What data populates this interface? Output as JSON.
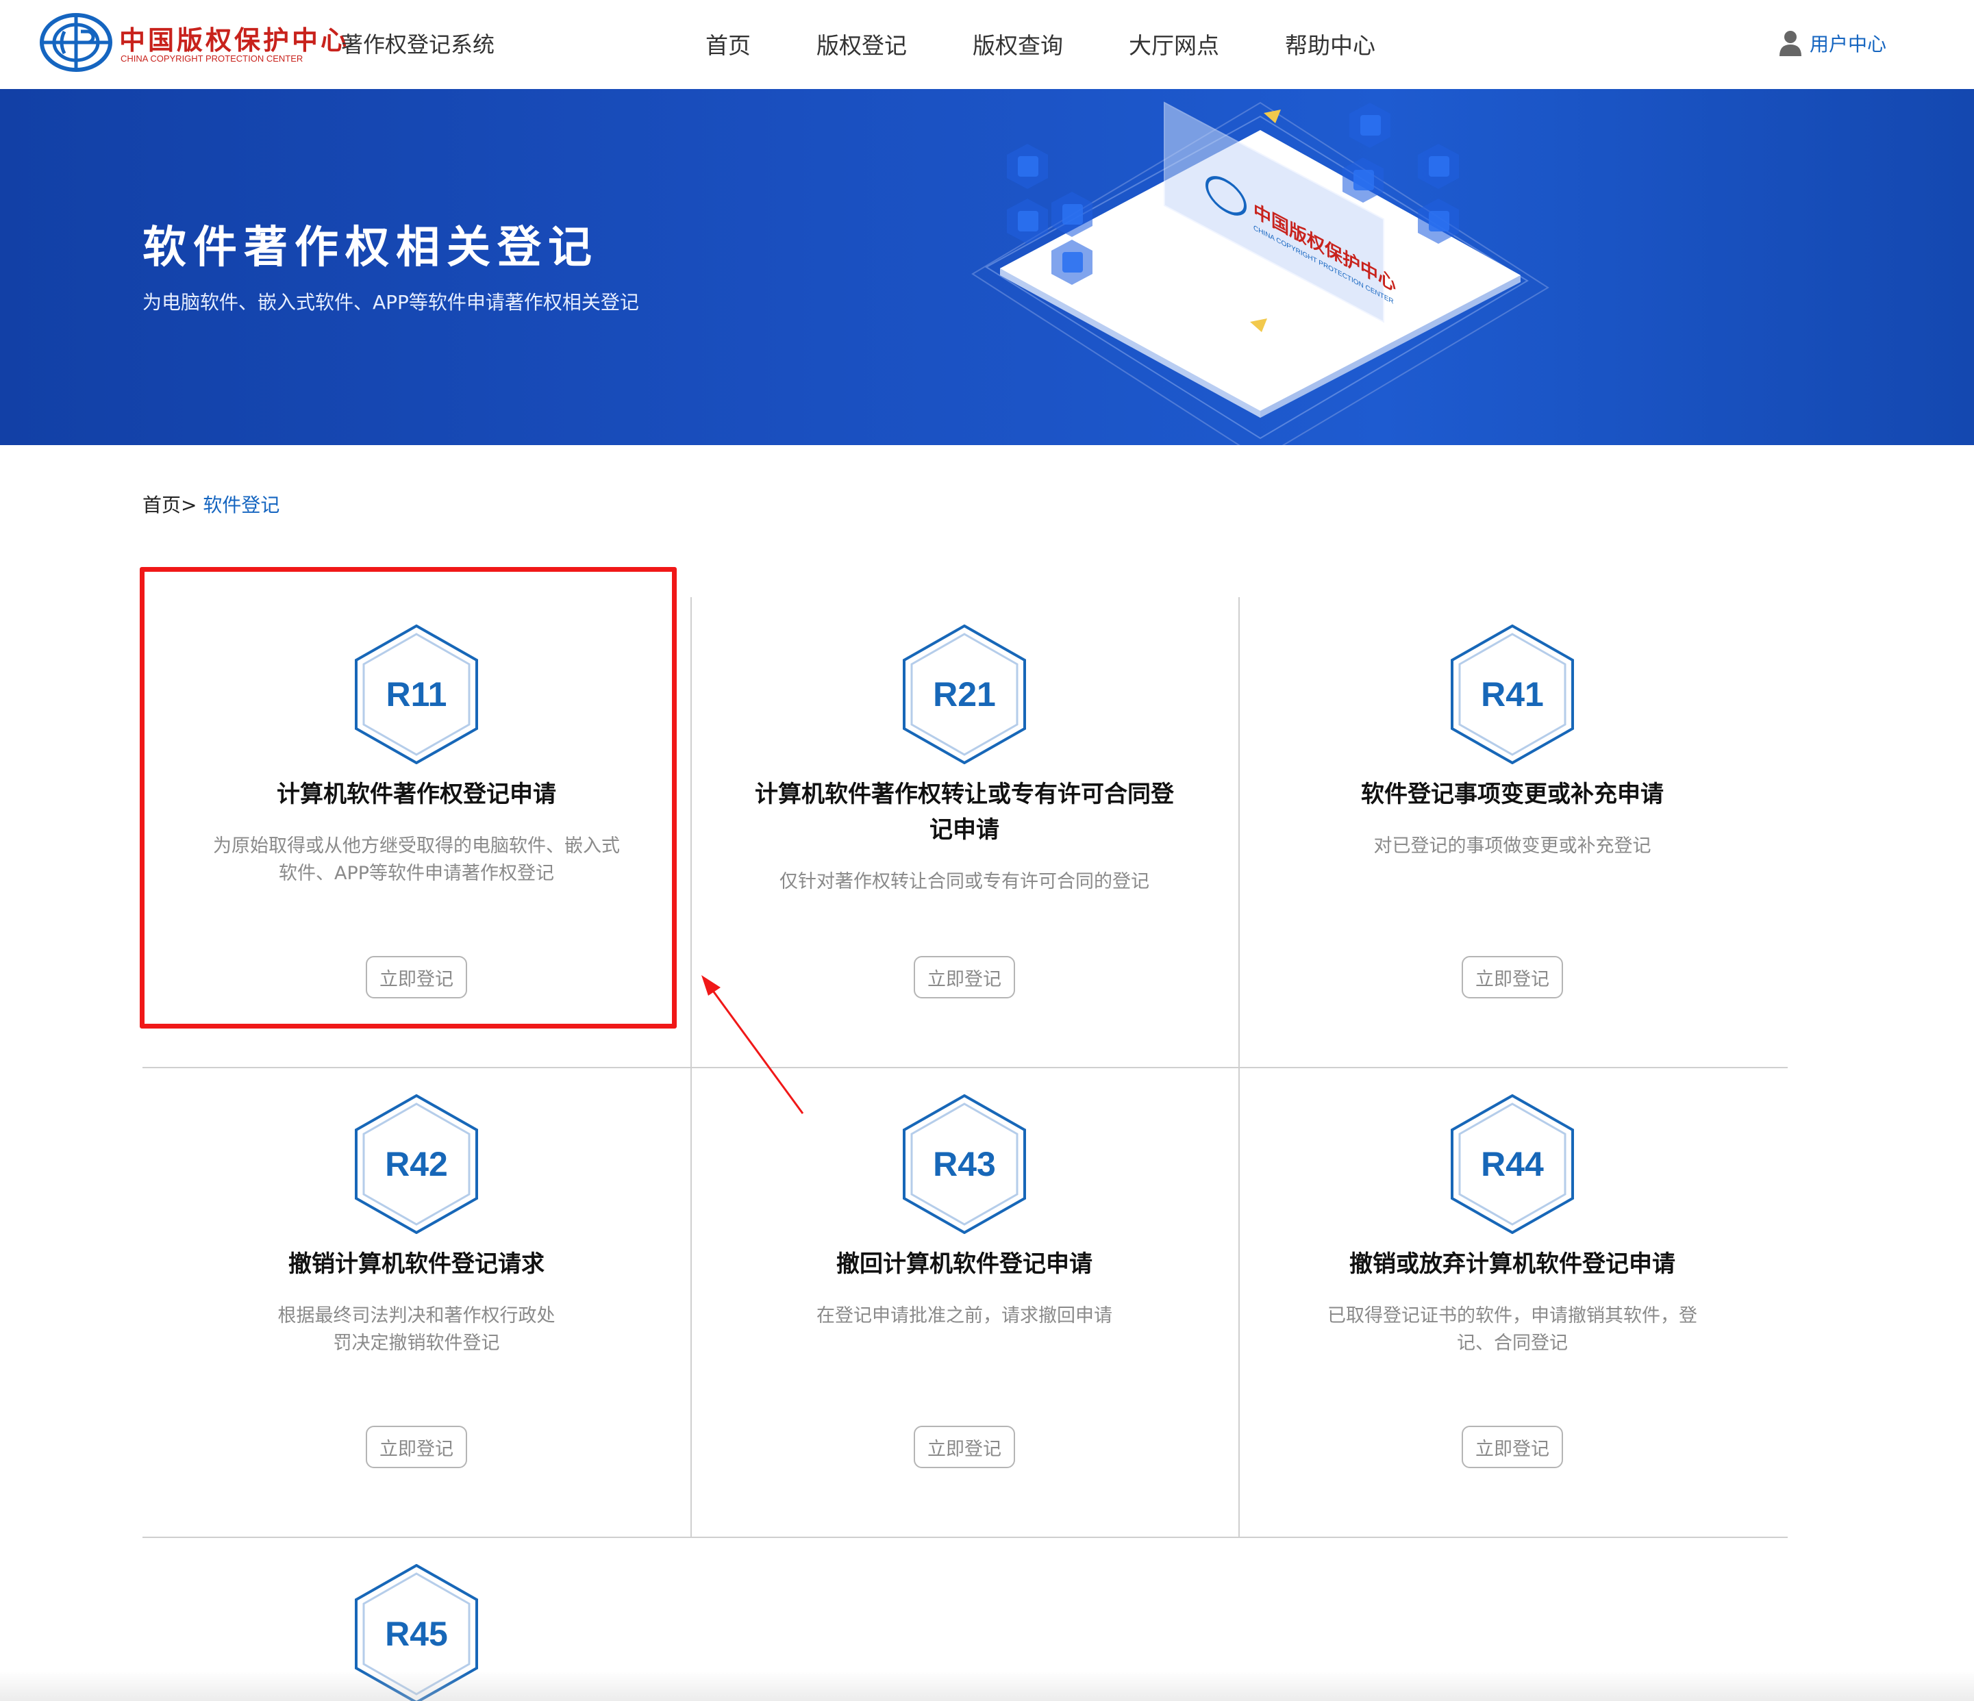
{
  "header": {
    "logo_cn": "中国版权保护中心",
    "logo_en": "CHINA COPYRIGHT PROTECTION CENTER",
    "system_name": "著作权登记系统",
    "nav": [
      "首页",
      "版权登记",
      "版权查询",
      "大厅网点",
      "帮助中心"
    ],
    "user_center": "用户中心"
  },
  "banner": {
    "title": "软件著作权相关登记",
    "subtitle": "为电脑软件、嵌入式软件、APP等软件申请著作权相关登记",
    "art_logo_cn": "中国版权保护中心",
    "art_logo_en": "CHINA COPYRIGHT PROTECTION CENTER"
  },
  "breadcrumb": {
    "home": "首页",
    "separator": ">",
    "current": "软件登记"
  },
  "cards": [
    {
      "code": "R11",
      "title": "计算机软件著作权登记申请",
      "desc": "为原始取得或从他方继受取得的电脑软件、嵌入式软件、APP等软件申请著作权登记",
      "button": "立即登记"
    },
    {
      "code": "R21",
      "title": "计算机软件著作权转让或专有许可合同登记申请",
      "desc": "仅针对著作权转让合同或专有许可合同的登记",
      "button": "立即登记"
    },
    {
      "code": "R41",
      "title": "软件登记事项变更或补充申请",
      "desc": "对已登记的事项做变更或补充登记",
      "button": "立即登记"
    },
    {
      "code": "R42",
      "title": "撤销计算机软件登记请求",
      "desc": "根据最终司法判决和著作权行政处罚决定撤销软件登记",
      "button": "立即登记"
    },
    {
      "code": "R43",
      "title": "撤回计算机软件登记申请",
      "desc": "在登记申请批准之前，请求撤回申请",
      "button": "立即登记"
    },
    {
      "code": "R44",
      "title": "撤销或放弃计算机软件登记申请",
      "desc": "已取得登记证书的软件，申请撤销其软件，登记、合同登记",
      "button": "立即登记"
    },
    {
      "code": "R45",
      "title": "",
      "desc": "",
      "button": ""
    }
  ],
  "colors": {
    "brand_red": "#c8221c",
    "link_blue": "#1565c0",
    "banner_blue": "#1a4fbf",
    "hex_blue": "#1767b8",
    "highlight_red": "#f01818"
  },
  "icons": [
    "ccpc-logo-icon",
    "user-icon",
    "hexagon-badge-icon"
  ]
}
